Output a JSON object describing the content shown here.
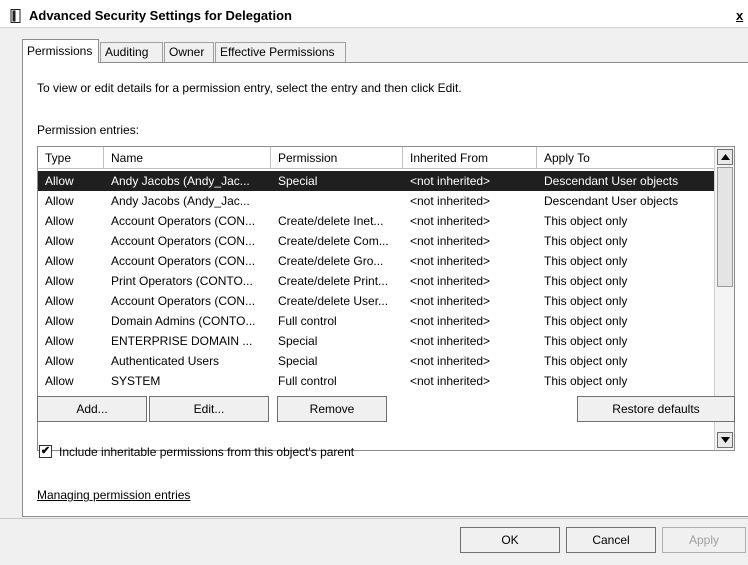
{
  "window": {
    "title": "Advanced Security Settings for Delegation",
    "close_label": "x"
  },
  "tabs": [
    {
      "label": "Permissions",
      "active": true
    },
    {
      "label": "Auditing",
      "active": false
    },
    {
      "label": "Owner",
      "active": false
    },
    {
      "label": "Effective Permissions",
      "active": false
    }
  ],
  "permissions": {
    "hint": "To view or edit details for a permission entry, select the entry and then click Edit.",
    "entries_label": "Permission entries:",
    "columns": [
      "Type",
      "Name",
      "Permission",
      "Inherited From",
      "Apply To"
    ],
    "rows": [
      {
        "type": "Allow",
        "name": "Andy Jacobs (Andy_Jac...",
        "permission": "Special",
        "inherited_from": "<not inherited>",
        "apply_to": "Descendant User objects",
        "selected": true
      },
      {
        "type": "Allow",
        "name": "Andy Jacobs (Andy_Jac...",
        "permission": "",
        "inherited_from": "<not inherited>",
        "apply_to": "Descendant User objects",
        "selected": false
      },
      {
        "type": "Allow",
        "name": "Account Operators (CON...",
        "permission": "Create/delete Inet...",
        "inherited_from": "<not inherited>",
        "apply_to": "This object only",
        "selected": false
      },
      {
        "type": "Allow",
        "name": "Account Operators (CON...",
        "permission": "Create/delete Com...",
        "inherited_from": "<not inherited>",
        "apply_to": "This object only",
        "selected": false
      },
      {
        "type": "Allow",
        "name": "Account Operators (CON...",
        "permission": "Create/delete Gro...",
        "inherited_from": "<not inherited>",
        "apply_to": "This object only",
        "selected": false
      },
      {
        "type": "Allow",
        "name": "Print Operators (CONTO...",
        "permission": "Create/delete Print...",
        "inherited_from": "<not inherited>",
        "apply_to": "This object only",
        "selected": false
      },
      {
        "type": "Allow",
        "name": "Account Operators (CON...",
        "permission": "Create/delete User...",
        "inherited_from": "<not inherited>",
        "apply_to": "This object only",
        "selected": false
      },
      {
        "type": "Allow",
        "name": "Domain Admins (CONTO...",
        "permission": "Full control",
        "inherited_from": "<not inherited>",
        "apply_to": "This object only",
        "selected": false
      },
      {
        "type": "Allow",
        "name": "ENTERPRISE DOMAIN ...",
        "permission": "Special",
        "inherited_from": "<not inherited>",
        "apply_to": "This object only",
        "selected": false
      },
      {
        "type": "Allow",
        "name": "Authenticated Users",
        "permission": "Special",
        "inherited_from": "<not inherited>",
        "apply_to": "This object only",
        "selected": false
      },
      {
        "type": "Allow",
        "name": "SYSTEM",
        "permission": "Full control",
        "inherited_from": "<not inherited>",
        "apply_to": "This object only",
        "selected": false
      }
    ],
    "buttons": {
      "add": "Add...",
      "edit": "Edit...",
      "remove": "Remove",
      "restore": "Restore defaults"
    },
    "include_inheritable": {
      "label": "Include inheritable permissions from this object's parent",
      "checked": true,
      "mark": "✔"
    },
    "managing_link": "Managing permission entries"
  },
  "footer": {
    "ok": "OK",
    "cancel": "Cancel",
    "apply": "Apply"
  }
}
